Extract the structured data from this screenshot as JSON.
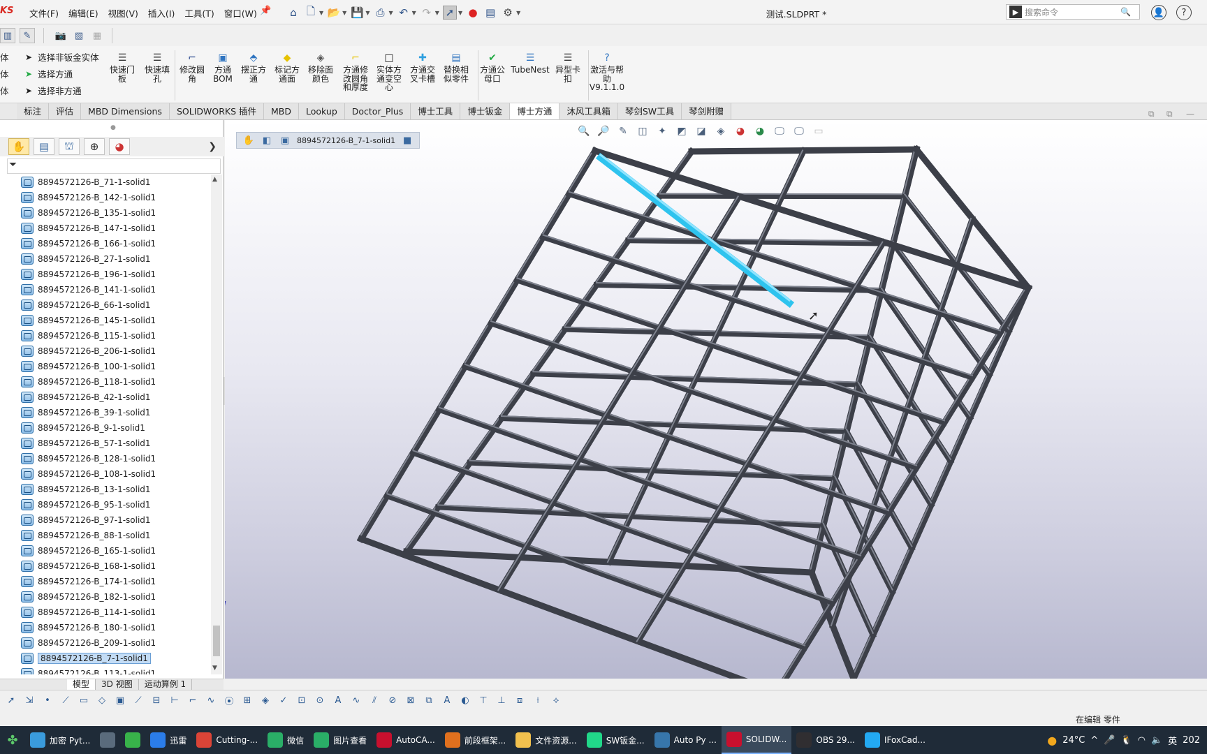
{
  "app": {
    "logo": "KS",
    "doc_title": "测试.SLDPRT *",
    "menus": [
      "文件(F)",
      "编辑(E)",
      "视图(V)",
      "插入(I)",
      "工具(T)",
      "窗口(W)"
    ],
    "search_placeholder": "搜索命令"
  },
  "ribbon": {
    "selectors": [
      "选择非钣金实体",
      "选择方通",
      "选择非方通"
    ],
    "cut_text": "体",
    "commands": [
      {
        "label": "快速门板",
        "icon": "door-panel-icon",
        "glyph": "☰",
        "color": "#333333"
      },
      {
        "label": "快速填孔",
        "icon": "fill-hole-icon",
        "glyph": "☰",
        "color": "#333333"
      },
      {
        "label": "修改圆角",
        "icon": "fillet-icon",
        "glyph": "⌐",
        "color": "#1f3f8a"
      },
      {
        "label": "方通BOM",
        "icon": "bom-icon",
        "glyph": "▣",
        "color": "#2f74c0"
      },
      {
        "label": "摆正方通",
        "icon": "align-tube-icon",
        "glyph": "⬘",
        "color": "#2f74c0"
      },
      {
        "label": "标记方通面",
        "icon": "mark-face-icon",
        "glyph": "◆",
        "color": "#e6c200"
      },
      {
        "label": "移除面颜色",
        "icon": "remove-color-icon",
        "glyph": "◈",
        "color": "#555555"
      },
      {
        "label": "方通修改圆角和厚度",
        "icon": "fillet-thickness-icon",
        "glyph": "⌐",
        "color": "#e6c200"
      },
      {
        "label": "实体方通变空心",
        "icon": "hollow-icon",
        "glyph": "□",
        "color": "#111111"
      },
      {
        "label": "方通交叉卡槽",
        "icon": "cross-slot-icon",
        "glyph": "✚",
        "color": "#2fa0e0"
      },
      {
        "label": "替换相似零件",
        "icon": "replace-part-icon",
        "glyph": "▤",
        "color": "#2f74c0"
      },
      {
        "label": "方通公母口",
        "icon": "male-female-icon",
        "glyph": "✔",
        "color": "#22aa44"
      },
      {
        "label": "TubeNest",
        "icon": "tubenest-icon",
        "glyph": "☰",
        "color": "#2f74c0"
      },
      {
        "label": "异型卡扣",
        "icon": "clip-icon",
        "glyph": "☰",
        "color": "#333333"
      },
      {
        "label": "激活与帮助V9.1.1.0",
        "icon": "help-icon",
        "glyph": "?",
        "color": "#2f74c0"
      }
    ]
  },
  "tabs": [
    {
      "label": "标注",
      "active": false
    },
    {
      "label": "评估",
      "active": false
    },
    {
      "label": "MBD Dimensions",
      "active": false
    },
    {
      "label": "SOLIDWORKS 插件",
      "active": false
    },
    {
      "label": "MBD",
      "active": false
    },
    {
      "label": "Lookup",
      "active": false
    },
    {
      "label": "Doctor_Plus",
      "active": false
    },
    {
      "label": "博士工具",
      "active": false
    },
    {
      "label": "博士钣金",
      "active": false
    },
    {
      "label": "博士方通",
      "active": true
    },
    {
      "label": "沐风工具箱",
      "active": false
    },
    {
      "label": "琴剑SW工具",
      "active": false
    },
    {
      "label": "琴剑附赠",
      "active": false
    }
  ],
  "tree": {
    "items": [
      "8894572126-B_71-1-solid1",
      "8894572126-B_142-1-solid1",
      "8894572126-B_135-1-solid1",
      "8894572126-B_147-1-solid1",
      "8894572126-B_166-1-solid1",
      "8894572126-B_27-1-solid1",
      "8894572126-B_196-1-solid1",
      "8894572126-B_141-1-solid1",
      "8894572126-B_66-1-solid1",
      "8894572126-B_145-1-solid1",
      "8894572126-B_115-1-solid1",
      "8894572126-B_206-1-solid1",
      "8894572126-B_100-1-solid1",
      "8894572126-B_118-1-solid1",
      "8894572126-B_42-1-solid1",
      "8894572126-B_39-1-solid1",
      "8894572126-B_9-1-solid1",
      "8894572126-B_57-1-solid1",
      "8894572126-B_128-1-solid1",
      "8894572126-B_108-1-solid1",
      "8894572126-B_13-1-solid1",
      "8894572126-B_95-1-solid1",
      "8894572126-B_97-1-solid1",
      "8894572126-B_88-1-solid1",
      "8894572126-B_165-1-solid1",
      "8894572126-B_168-1-solid1",
      "8894572126-B_174-1-solid1",
      "8894572126-B_182-1-solid1",
      "8894572126-B_114-1-solid1",
      "8894572126-B_180-1-solid1",
      "8894572126-B_209-1-solid1",
      "8894572126-B_7-1-solid1",
      "8894572126-B_113-1-solid1"
    ],
    "selected_index": 31
  },
  "breadcrumb": {
    "label": "8894572126-B_7-1-solid1"
  },
  "bottom_tabs": [
    {
      "label": "模型",
      "active": true
    },
    {
      "label": "3D 视图",
      "active": false
    },
    {
      "label": "运动算例 1",
      "active": false
    }
  ],
  "status": {
    "text": "在编辑 零件"
  },
  "taskbar": {
    "apps": [
      {
        "label": "加密 Pyt...",
        "icon": "python-encrypt-icon",
        "color": "#3a9bdc",
        "active": false
      },
      {
        "label": "",
        "icon": "calculator-icon",
        "color": "#5a6b7c",
        "active": false
      },
      {
        "label": "",
        "icon": "green-app-icon",
        "color": "#38b24a",
        "active": false
      },
      {
        "label": "迅雷",
        "icon": "xunlei-icon",
        "color": "#2b7de9",
        "active": false
      },
      {
        "label": "Cutting-...",
        "icon": "chrome-icon",
        "color": "#db4437",
        "active": false
      },
      {
        "label": "微信",
        "icon": "wechat-icon",
        "color": "#2aae67",
        "active": false
      },
      {
        "label": "图片查看",
        "icon": "image-viewer-icon",
        "color": "#2aae67",
        "active": false
      },
      {
        "label": "AutoCA...",
        "icon": "autocad-icon",
        "color": "#c8102e",
        "active": false
      },
      {
        "label": "前段框架...",
        "icon": "search-file-icon",
        "color": "#e0701e",
        "active": false
      },
      {
        "label": "文件资源...",
        "icon": "folder-icon",
        "color": "#f2c14e",
        "active": false
      },
      {
        "label": "SW钣金...",
        "icon": "pycharm-icon",
        "color": "#21d789",
        "active": false
      },
      {
        "label": "Auto Py ...",
        "icon": "python-icon",
        "color": "#3776ab",
        "active": false
      },
      {
        "label": "SOLIDW...",
        "icon": "solidworks-icon",
        "color": "#c8102e",
        "active": true
      },
      {
        "label": "OBS 29...",
        "icon": "obs-icon",
        "color": "#302e31",
        "active": false
      },
      {
        "label": "IFoxCad...",
        "icon": "vscode-icon",
        "color": "#23a9f2",
        "active": false
      }
    ],
    "weather": "24°C",
    "ime": "英",
    "clock_partial": "202"
  }
}
